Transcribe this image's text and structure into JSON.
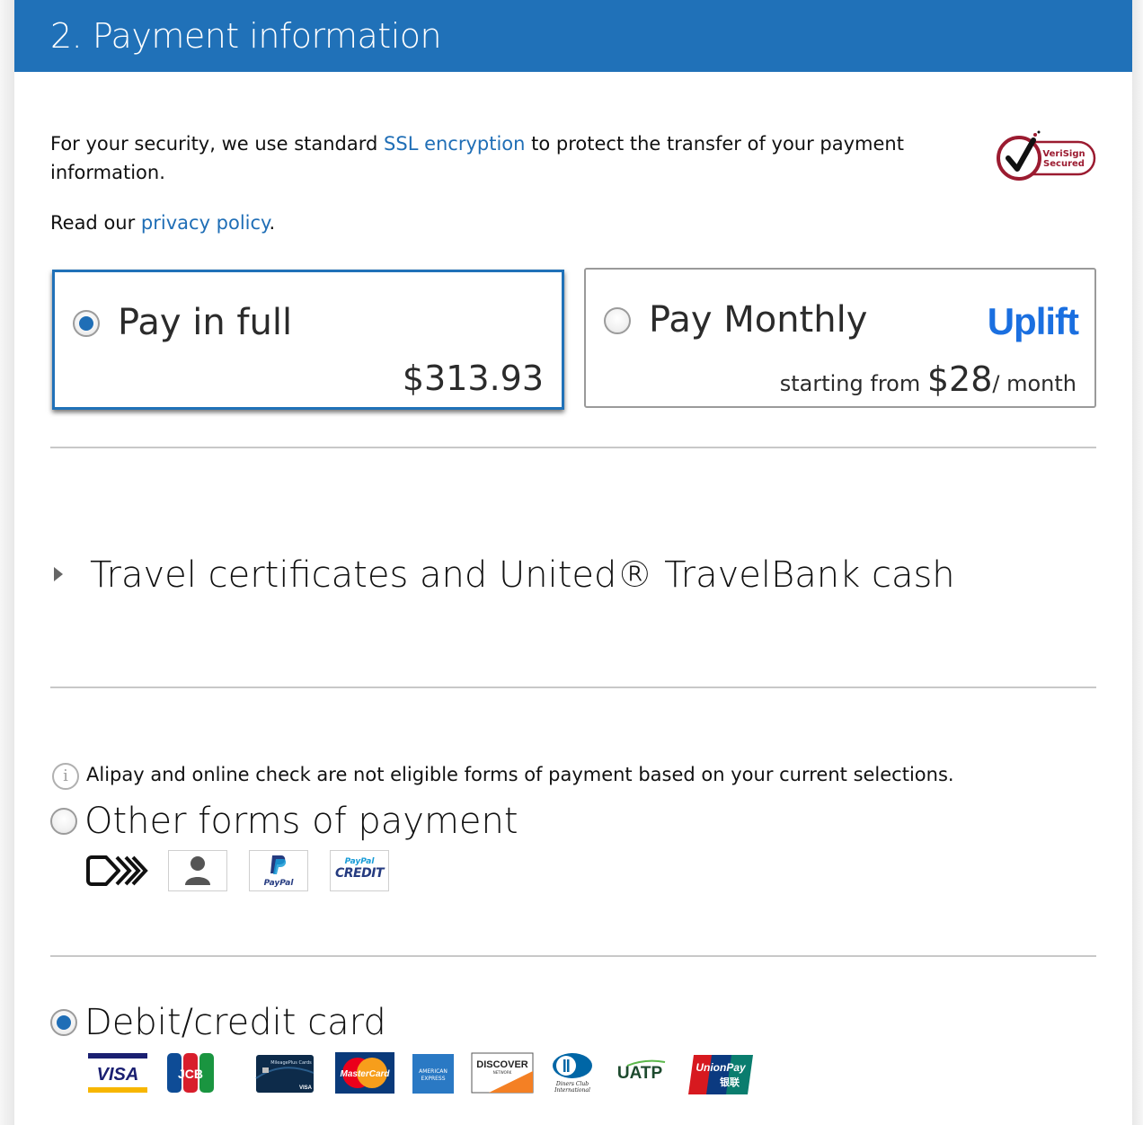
{
  "header": {
    "title": "2. Payment information"
  },
  "security": {
    "text_before": "For your security, we use standard ",
    "ssl_link": "SSL encryption",
    "text_after": " to protect the transfer of your payment information.",
    "privacy_prefix": "Read our ",
    "privacy_link": "privacy policy",
    "privacy_suffix": ".",
    "badge": {
      "line1": "VeriSign",
      "line2": "Secured",
      "icon": "verisign-check-icon",
      "color": "#9b1b30"
    }
  },
  "payment_options": {
    "pay_in_full": {
      "label": "Pay in full",
      "price": "$313.93",
      "selected": true
    },
    "pay_monthly": {
      "label": "Pay Monthly",
      "provider": "Uplift",
      "prefix": "starting from ",
      "amount": "$28",
      "suffix": "/ month",
      "selected": false
    }
  },
  "travel_certificates": {
    "label": "Travel certificates and United® TravelBank cash",
    "expanded": false
  },
  "notice": {
    "icon": "info-icon",
    "text": "Alipay and online check are not eligible forms of payment based on your current selections."
  },
  "other_forms": {
    "label": "Other forms of payment",
    "selected": false,
    "icons": [
      {
        "name": "forward-pay-icon"
      },
      {
        "name": "person-account-icon"
      },
      {
        "name": "paypal-icon",
        "text": "PayPal"
      },
      {
        "name": "paypal-credit-icon",
        "text_top": "PayPal",
        "text_bottom": "CREDIT"
      }
    ]
  },
  "card": {
    "label": "Debit/credit card",
    "selected": true,
    "brands": [
      {
        "name": "visa",
        "text": "VISA"
      },
      {
        "name": "jcb",
        "text": "JCB"
      },
      {
        "name": "mileageplus-visa",
        "text": "MileagePlus Cards"
      },
      {
        "name": "mastercard",
        "text": "MasterCard"
      },
      {
        "name": "american-express",
        "text": "AMERICAN EXPRESS"
      },
      {
        "name": "discover",
        "text": "DISCOVER",
        "sub": "NETWORK"
      },
      {
        "name": "diners-club",
        "text": "Diners Club International"
      },
      {
        "name": "uatp",
        "text": "UATP"
      },
      {
        "name": "unionpay",
        "text": "UnionPay",
        "sub": "银联"
      }
    ]
  },
  "colors": {
    "brand_blue": "#2071b8",
    "link": "#1f6eb6",
    "uplift": "#1a6fe0"
  }
}
